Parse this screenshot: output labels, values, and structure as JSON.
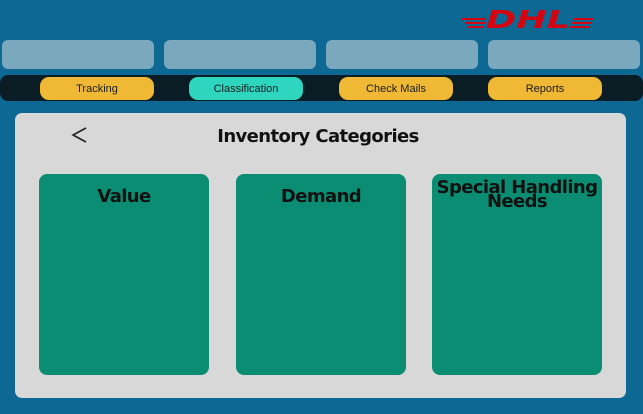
{
  "brand": {
    "logo_text": "DHL",
    "primary_color": "#d40511",
    "accent_color": "#efb935"
  },
  "nav": {
    "items": [
      {
        "label": "Tracking"
      },
      {
        "label": "Classification",
        "active": true
      },
      {
        "label": "Check Mails"
      },
      {
        "label": "Reports"
      }
    ]
  },
  "main": {
    "title": "Inventory Categories",
    "back_icon": "chevron-left-icon",
    "categories": [
      {
        "label": "Value"
      },
      {
        "label": "Demand"
      },
      {
        "label": "Special Handling Needs"
      }
    ]
  }
}
